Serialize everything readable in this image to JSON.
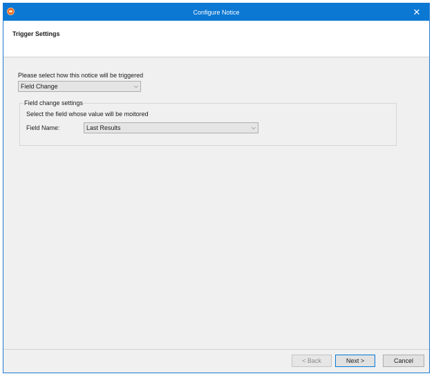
{
  "window": {
    "title": "Configure Notice",
    "close_glyph": "✕",
    "app_icon": "app-logo-icon"
  },
  "header": {
    "title": "Trigger Settings"
  },
  "trigger": {
    "label": "Please select how this notice will be triggered",
    "selected": "Field Change",
    "chevron": "⌵"
  },
  "field_change_group": {
    "legend": "Field change settings",
    "hint": "Select the field whose value will be moitored",
    "field_name_label": "Field Name:",
    "field_name_selected": "Last Results",
    "chevron": "⌵"
  },
  "footer": {
    "back_label": "< Back",
    "next_label": "Next >",
    "cancel_label": "Cancel"
  },
  "colors": {
    "titlebar": "#0b78d4",
    "dialog_bg": "#f0f0f0",
    "header_bg": "#ffffff",
    "default_button_border": "#0078d7"
  }
}
